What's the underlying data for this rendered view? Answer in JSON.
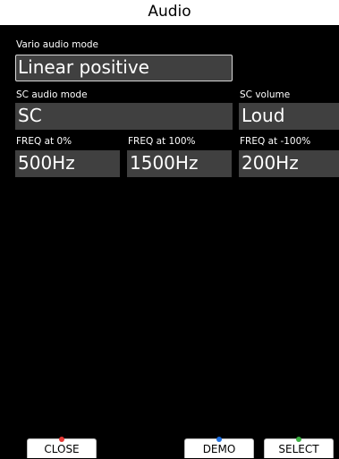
{
  "title": "Audio",
  "vario": {
    "label": "Vario audio mode",
    "value": "Linear positive"
  },
  "sc_mode": {
    "label": "SC audio mode",
    "value": "SC"
  },
  "sc_volume": {
    "label": "SC volume",
    "value": "Loud"
  },
  "freq0": {
    "label": "FREQ at 0%",
    "value": "500Hz"
  },
  "freq100": {
    "label": "FREQ at 100%",
    "value": "1500Hz"
  },
  "freqm100": {
    "label": "FREQ at -100%",
    "value": "200Hz"
  },
  "buttons": {
    "close": {
      "label": "CLOSE",
      "indicator_color": "#e53935"
    },
    "demo": {
      "label": "DEMO",
      "indicator_color": "#1e6fe0"
    },
    "select": {
      "label": "SELECT",
      "indicator_color": "#3cb043"
    }
  }
}
